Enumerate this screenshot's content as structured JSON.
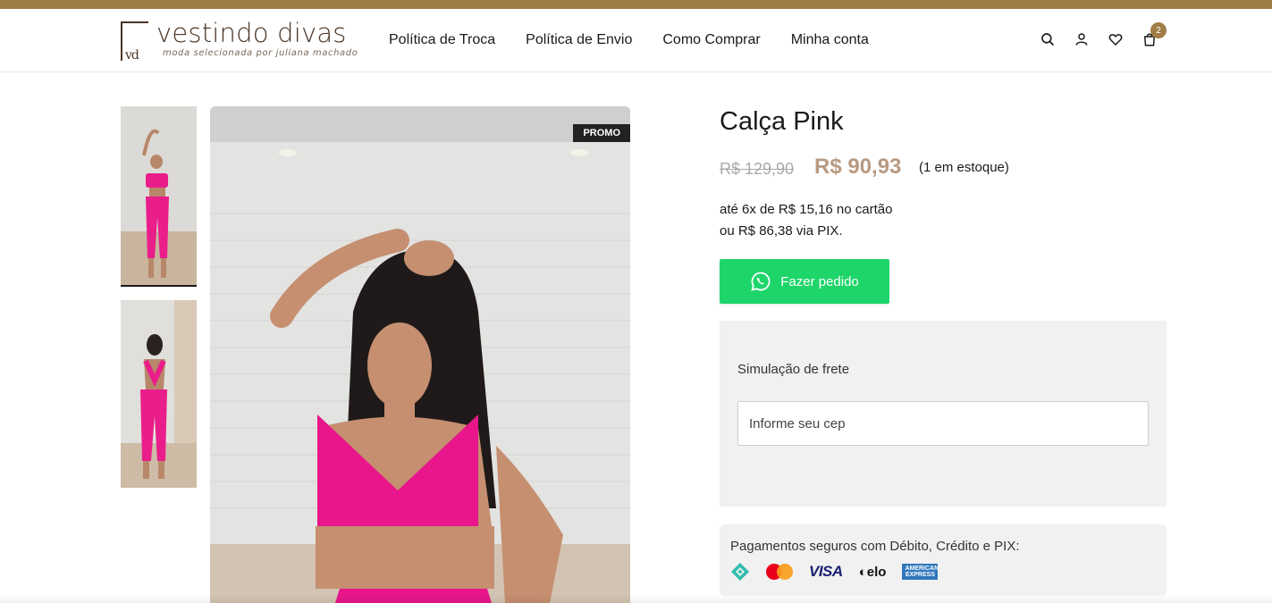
{
  "brand": {
    "name": "vestindo divas",
    "tagline": "moda selecionada por juliana machado",
    "monogram": "vd",
    "accent_color": "#a07d45"
  },
  "nav": [
    {
      "label": "Política de Troca"
    },
    {
      "label": "Política de Envio"
    },
    {
      "label": "Como Comprar"
    },
    {
      "label": "Minha conta"
    }
  ],
  "header_icons": {
    "search": "search-icon",
    "account": "user-icon",
    "wishlist": "heart-icon",
    "cart": "bag-icon",
    "cart_count": "2"
  },
  "gallery": {
    "badge": "PROMO",
    "thumbnails": [
      "thumb-front",
      "thumb-back"
    ],
    "selected_index": 0
  },
  "product": {
    "title": "Calça Pink",
    "price_old": "R$ 129,90",
    "price_new": "R$ 90,93",
    "stock": "(1 em estoque)",
    "installments": "até 6x de R$ 15,16 no cartão",
    "pix": "ou R$ 86,38 via PIX.",
    "price_color": "#b89a82"
  },
  "order_button": {
    "label": "Fazer pedido",
    "icon": "whatsapp-icon",
    "color": "#1ed56a"
  },
  "shipping": {
    "title": "Simulação de frete",
    "placeholder": "Informe seu cep"
  },
  "payments": {
    "title": "Pagamentos seguros com Débito, Crédito e PIX:",
    "methods": [
      "pix",
      "mastercard",
      "visa",
      "elo",
      "american-express"
    ],
    "visa_label": "VISA",
    "elo_label": "elo",
    "amex_label": "AMERICAN EXPRESS"
  }
}
